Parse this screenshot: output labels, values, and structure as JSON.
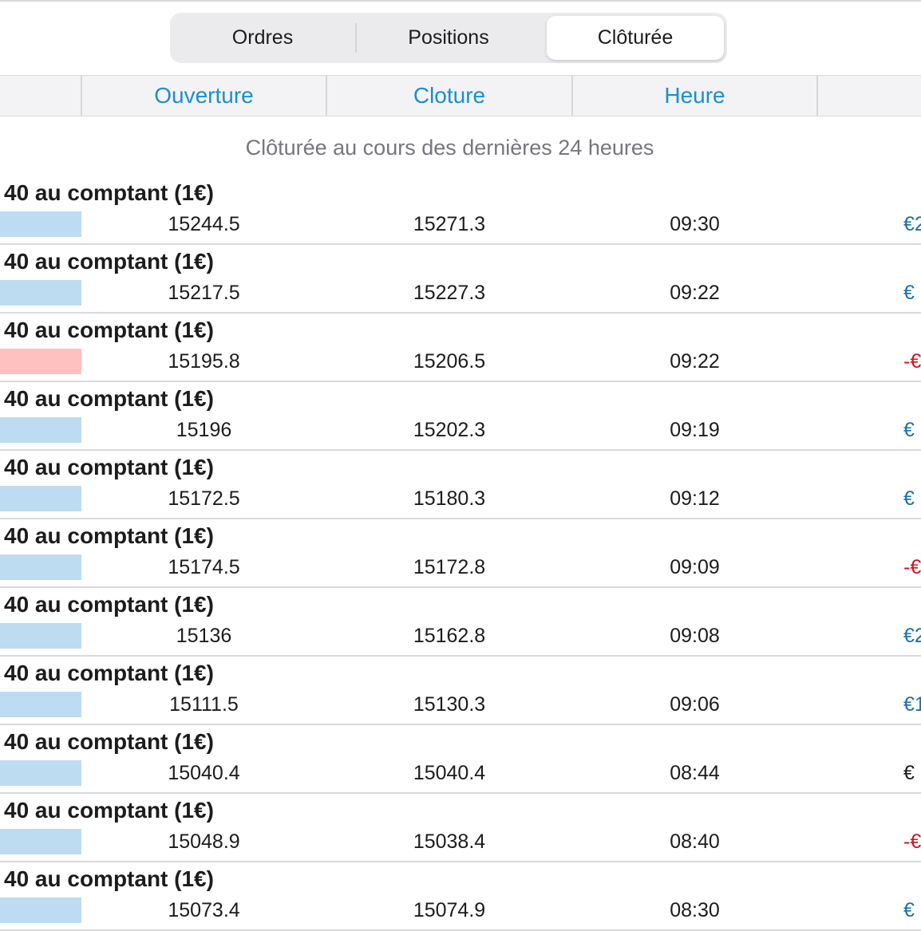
{
  "tabs": {
    "items": [
      {
        "label": "Ordres",
        "selected": false
      },
      {
        "label": "Positions",
        "selected": false
      },
      {
        "label": "Clôturée",
        "selected": true
      }
    ]
  },
  "columns": {
    "headers": [
      "Ouverture",
      "Cloture",
      "Heure"
    ]
  },
  "section": {
    "title": "Clôturée au cours des dernières 24 heures"
  },
  "colors": {
    "accent": "#1a8fd1",
    "buy_bar": "#bddcf1",
    "sell_bar": "#ffc0c0",
    "profit": "#1a6fb0",
    "loss": "#d0141e",
    "neutral": "#1c1c1e"
  },
  "trades": [
    {
      "instrument": "40 au comptant (1€)",
      "direction": "buy",
      "open": "15244.5",
      "close": "15271.3",
      "time": "09:30",
      "pl": "€2",
      "pl_tone": "profit"
    },
    {
      "instrument": "40 au comptant (1€)",
      "direction": "buy",
      "open": "15217.5",
      "close": "15227.3",
      "time": "09:22",
      "pl": "€",
      "pl_tone": "profit"
    },
    {
      "instrument": "40 au comptant (1€)",
      "direction": "sell",
      "open": "15195.8",
      "close": "15206.5",
      "time": "09:22",
      "pl": "-€",
      "pl_tone": "loss"
    },
    {
      "instrument": "40 au comptant (1€)",
      "direction": "buy",
      "open": "15196",
      "close": "15202.3",
      "time": "09:19",
      "pl": "€",
      "pl_tone": "profit"
    },
    {
      "instrument": "40 au comptant (1€)",
      "direction": "buy",
      "open": "15172.5",
      "close": "15180.3",
      "time": "09:12",
      "pl": "€",
      "pl_tone": "profit"
    },
    {
      "instrument": "40 au comptant (1€)",
      "direction": "buy",
      "open": "15174.5",
      "close": "15172.8",
      "time": "09:09",
      "pl": "-€",
      "pl_tone": "loss"
    },
    {
      "instrument": "40 au comptant (1€)",
      "direction": "buy",
      "open": "15136",
      "close": "15162.8",
      "time": "09:08",
      "pl": "€2",
      "pl_tone": "profit"
    },
    {
      "instrument": "40 au comptant (1€)",
      "direction": "buy",
      "open": "15111.5",
      "close": "15130.3",
      "time": "09:06",
      "pl": "€1",
      "pl_tone": "profit"
    },
    {
      "instrument": "40 au comptant (1€)",
      "direction": "buy",
      "open": "15040.4",
      "close": "15040.4",
      "time": "08:44",
      "pl": "€",
      "pl_tone": "neutral"
    },
    {
      "instrument": "40 au comptant (1€)",
      "direction": "buy",
      "open": "15048.9",
      "close": "15038.4",
      "time": "08:40",
      "pl": "-€",
      "pl_tone": "loss"
    },
    {
      "instrument": "40 au comptant (1€)",
      "direction": "buy",
      "open": "15073.4",
      "close": "15074.9",
      "time": "08:30",
      "pl": "€",
      "pl_tone": "profit"
    }
  ]
}
